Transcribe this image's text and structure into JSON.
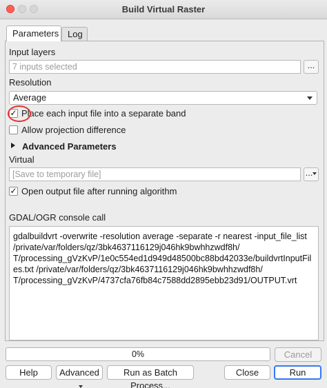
{
  "window": {
    "title": "Build Virtual Raster"
  },
  "tabs": [
    {
      "label": "Parameters",
      "active": true
    },
    {
      "label": "Log",
      "active": false
    }
  ],
  "params": {
    "input_layers_label": "Input layers",
    "input_layers_value": "7 inputs selected",
    "browse_label": "...",
    "resolution_label": "Resolution",
    "resolution_value": "Average",
    "separate_label": "Place each input file into a separate band",
    "separate_checked": true,
    "projection_label": "Allow projection difference",
    "projection_checked": false,
    "advanced_label": "Advanced Parameters",
    "virtual_label": "Virtual",
    "virtual_placeholder": "[Save to temporary file]",
    "open_output_label": "Open output file after running algorithm",
    "open_output_checked": true,
    "console_label": "GDAL/OGR console call",
    "console_text": "gdalbuildvrt -overwrite -resolution average -separate -r nearest -input_file_list /private/var/folders/qz/3bk4637116129j046hk9bwhhzwdf8h/ T/processing_gVzKvP/1e0c554ed1d949d48500bc88bd42033e/buildvrtInputFiles.txt /private/var/folders/qz/3bk4637116129j046hk9bwhhzwdf8h/ T/processing_gVzKvP/4737cfa76fb84c7588dd2895ebb23d91/OUTPUT.vrt"
  },
  "footer": {
    "progress_text": "0%",
    "progress_value": 0,
    "cancel_label": "Cancel",
    "help_label": "Help",
    "advanced_label": "Advanced",
    "batch_label": "Run as Batch Process...",
    "close_label": "Close",
    "run_label": "Run"
  },
  "colors": {
    "highlight_ring": "#e3342f",
    "default_button": "#3478f6",
    "close_light": "#fe5f57"
  },
  "icons": {
    "dropdown": "chevron-down-icon",
    "collapse": "triangle-right-icon",
    "check": "checkmark-icon"
  }
}
